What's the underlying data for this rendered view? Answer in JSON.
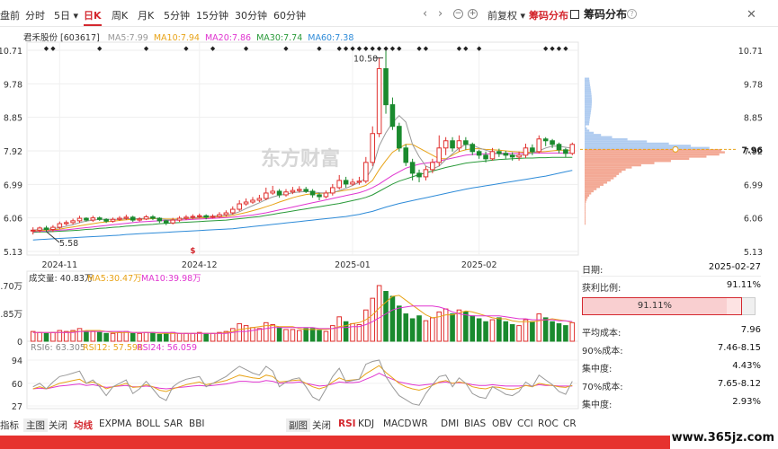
{
  "toolbar": {
    "timeframes": [
      {
        "label": "盘前",
        "active": false
      },
      {
        "label": "分时",
        "active": false
      },
      {
        "label": "5日",
        "active": false,
        "dropdown": true
      },
      {
        "label": "日K",
        "active": true
      },
      {
        "label": "周K",
        "active": false
      },
      {
        "label": "月K",
        "active": false
      },
      {
        "label": "5分钟",
        "active": false
      },
      {
        "label": "15分钟",
        "active": false
      },
      {
        "label": "30分钟",
        "active": false
      },
      {
        "label": "60分钟",
        "active": false
      }
    ],
    "adjust_label": "前复权",
    "chip_label": "筹码分布",
    "chip_toggle_label": "筹码分布"
  },
  "legend": {
    "stock": "君禾股份 [603617]",
    "ma": [
      {
        "label": "MA5:7.99",
        "color": "#999999"
      },
      {
        "label": "MA10:7.94",
        "color": "#e8a317"
      },
      {
        "label": "MA20:7.86",
        "color": "#e035d0"
      },
      {
        "label": "MA30:7.74",
        "color": "#2a9a3a"
      },
      {
        "label": "MA60:7.38",
        "color": "#2e8bd8"
      }
    ]
  },
  "price_axis": {
    "ticks": [
      "10.71",
      "9.78",
      "8.85",
      "7.92",
      "6.99",
      "6.06",
      "5.13"
    ],
    "right_ticks": [
      "10.71",
      "9.78",
      "8.85",
      "7.92",
      "6.99",
      "6.06",
      "5.13"
    ],
    "min": 5.13,
    "max": 10.71
  },
  "date_axis": [
    "2024-11",
    "2024-12",
    "2025-01",
    "2025-02"
  ],
  "annotations": {
    "high_label": "10.50",
    "low_label": "5.58",
    "current_price": "7.96",
    "watermark": "东方财富"
  },
  "volume": {
    "legend": {
      "label": "成交量: 40.83万",
      "ma5": "MA5:30.47万",
      "ma10": "MA10:39.98万"
    },
    "ticks": [
      "5.70万",
      "2.85万",
      "0"
    ]
  },
  "rsi": {
    "legend": {
      "rsi6": "RSI6: 63.305",
      "rsi12": "RSI12: 57.598",
      "rsi24": "RSI24: 56.059"
    },
    "ticks": [
      "94",
      "60",
      "27"
    ]
  },
  "chip_panel": {
    "date_label": "日期:",
    "date_value": "2025-02-27",
    "profit_label": "获利比例:",
    "profit_value": "91.11%",
    "profit_ratio": 0.9111,
    "bar_text": "91.11%",
    "stats": [
      {
        "label": "平均成本:",
        "value": "7.96"
      },
      {
        "label": "90%成本:",
        "value": "7.46-8.15"
      },
      {
        "label": "集中度:",
        "value": "4.43%"
      },
      {
        "label": "70%成本:",
        "value": "7.65-8.12"
      },
      {
        "label": "集中度:",
        "value": "2.93%"
      }
    ]
  },
  "bottom_tabs_left": [
    {
      "label": "指标",
      "active": false
    },
    {
      "label": "主图",
      "active": false,
      "box": true
    },
    {
      "label": "关闭",
      "active": false
    },
    {
      "label": "均线",
      "active": true
    },
    {
      "label": "EXPMA",
      "active": false
    },
    {
      "label": "BOLL",
      "active": false
    },
    {
      "label": "SAR",
      "active": false
    },
    {
      "label": "BBI",
      "active": false
    }
  ],
  "bottom_tabs_right": [
    {
      "label": "副图",
      "active": false,
      "box": true
    },
    {
      "label": "关闭",
      "active": false
    },
    {
      "label": "RSI",
      "active": true
    },
    {
      "label": "KDJ",
      "active": false
    },
    {
      "label": "MACD",
      "active": false
    },
    {
      "label": "WR",
      "active": false
    },
    {
      "label": "DMI",
      "active": false
    },
    {
      "label": "BIAS",
      "active": false
    },
    {
      "label": "OBV",
      "active": false
    },
    {
      "label": "CCI",
      "active": false
    },
    {
      "label": "ROC",
      "active": false
    },
    {
      "label": "CR",
      "active": false
    }
  ],
  "site_watermark": "www.365jz.com",
  "colors": {
    "up": "#e0302e",
    "down": "#1a8a2e",
    "accent": "#d4282f"
  },
  "chart_data": {
    "type": "candlestick",
    "dates": [
      "2024-10-28",
      "2024-10-29",
      "2024-10-30",
      "2024-10-31",
      "2024-11-01",
      "2024-11-04",
      "2024-11-05",
      "2024-11-06",
      "2024-11-07",
      "2024-11-08",
      "2024-11-11",
      "2024-11-12",
      "2024-11-13",
      "2024-11-14",
      "2024-11-15",
      "2024-11-18",
      "2024-11-19",
      "2024-11-20",
      "2024-11-21",
      "2024-11-22",
      "2024-11-25",
      "2024-11-26",
      "2024-11-27",
      "2024-11-28",
      "2024-11-29",
      "2024-12-02",
      "2024-12-03",
      "2024-12-04",
      "2024-12-05",
      "2024-12-06",
      "2024-12-09",
      "2024-12-10",
      "2024-12-11",
      "2024-12-12",
      "2024-12-13",
      "2024-12-16",
      "2024-12-17",
      "2024-12-18",
      "2024-12-19",
      "2024-12-20",
      "2024-12-23",
      "2024-12-24",
      "2024-12-25",
      "2024-12-26",
      "2024-12-27",
      "2024-12-30",
      "2024-12-31",
      "2025-01-02",
      "2025-01-03",
      "2025-01-06",
      "2025-01-07",
      "2025-01-08",
      "2025-01-09",
      "2025-01-10",
      "2025-01-13",
      "2025-01-14",
      "2025-01-15",
      "2025-01-16",
      "2025-01-17",
      "2025-01-20",
      "2025-01-21",
      "2025-01-22",
      "2025-01-23",
      "2025-01-24",
      "2025-01-27",
      "2025-02-05",
      "2025-02-06",
      "2025-02-07",
      "2025-02-10",
      "2025-02-11",
      "2025-02-12",
      "2025-02-13",
      "2025-02-14",
      "2025-02-17",
      "2025-02-18",
      "2025-02-19",
      "2025-02-20",
      "2025-02-21",
      "2025-02-24",
      "2025-02-25",
      "2025-02-26",
      "2025-02-27"
    ],
    "open": [
      5.7,
      5.72,
      5.78,
      5.74,
      5.8,
      5.9,
      5.93,
      5.98,
      6.05,
      6.0,
      6.06,
      6.02,
      5.97,
      6.02,
      6.05,
      6.08,
      6.0,
      6.03,
      6.09,
      6.05,
      5.98,
      5.92,
      6.0,
      6.05,
      6.08,
      6.1,
      6.12,
      6.08,
      6.1,
      6.15,
      6.2,
      6.3,
      6.45,
      6.5,
      6.55,
      6.6,
      6.75,
      6.8,
      6.7,
      6.78,
      6.82,
      6.85,
      6.8,
      6.7,
      6.65,
      6.75,
      6.9,
      7.1,
      7.0,
      7.05,
      7.08,
      7.6,
      8.4,
      10.2,
      9.2,
      8.6,
      8.0,
      7.6,
      7.3,
      7.2,
      7.4,
      7.6,
      8.0,
      8.2,
      8.0,
      8.2,
      8.1,
      7.9,
      7.8,
      7.7,
      7.9,
      7.85,
      7.8,
      7.75,
      7.8,
      8.0,
      7.9,
      8.25,
      8.2,
      8.1,
      7.95,
      7.85
    ],
    "close": [
      5.72,
      5.78,
      5.74,
      5.8,
      5.9,
      5.93,
      5.98,
      6.05,
      6.0,
      6.06,
      6.02,
      5.97,
      6.02,
      6.05,
      6.08,
      6.0,
      6.03,
      6.09,
      6.05,
      5.98,
      5.92,
      6.0,
      6.05,
      6.08,
      6.1,
      6.12,
      6.08,
      6.1,
      6.15,
      6.2,
      6.3,
      6.45,
      6.5,
      6.55,
      6.6,
      6.75,
      6.8,
      6.7,
      6.78,
      6.82,
      6.85,
      6.8,
      6.7,
      6.65,
      6.75,
      6.9,
      7.1,
      7.0,
      7.05,
      7.08,
      7.6,
      8.4,
      10.2,
      9.2,
      8.6,
      8.0,
      7.6,
      7.3,
      7.2,
      7.4,
      7.6,
      8.0,
      8.2,
      8.0,
      8.2,
      8.1,
      7.9,
      7.8,
      7.7,
      7.9,
      7.85,
      7.8,
      7.75,
      7.8,
      8.0,
      7.9,
      8.25,
      8.2,
      8.1,
      7.95,
      7.85,
      8.1
    ],
    "high": [
      5.8,
      5.82,
      5.84,
      5.86,
      5.96,
      5.99,
      6.04,
      6.12,
      6.08,
      6.12,
      6.1,
      6.05,
      6.07,
      6.11,
      6.15,
      6.12,
      6.08,
      6.14,
      6.14,
      6.08,
      6.0,
      6.06,
      6.11,
      6.14,
      6.16,
      6.18,
      6.16,
      6.16,
      6.22,
      6.27,
      6.38,
      6.55,
      6.6,
      6.64,
      6.7,
      6.9,
      6.95,
      6.86,
      6.86,
      6.92,
      6.94,
      6.92,
      6.86,
      6.76,
      6.82,
      7.0,
      7.25,
      7.2,
      7.15,
      7.2,
      7.75,
      8.6,
      10.5,
      10.71,
      9.4,
      8.7,
      8.1,
      7.7,
      7.4,
      7.5,
      7.7,
      8.35,
      8.3,
      8.3,
      8.35,
      8.3,
      8.15,
      7.95,
      7.9,
      8.0,
      7.98,
      7.92,
      7.88,
      7.9,
      8.12,
      8.1,
      8.35,
      8.3,
      8.25,
      8.15,
      8.0,
      8.15
    ],
    "low": [
      5.6,
      5.65,
      5.68,
      5.67,
      5.75,
      5.85,
      5.88,
      5.92,
      5.96,
      5.95,
      5.98,
      5.92,
      5.93,
      5.98,
      6.0,
      5.95,
      5.96,
      6.0,
      6.0,
      5.92,
      5.86,
      5.88,
      5.95,
      6.0,
      6.02,
      6.05,
      6.02,
      6.04,
      6.06,
      6.1,
      6.15,
      6.25,
      6.4,
      6.45,
      6.5,
      6.55,
      6.7,
      6.62,
      6.65,
      6.72,
      6.76,
      6.75,
      6.62,
      6.55,
      6.6,
      6.68,
      6.85,
      6.9,
      6.95,
      6.98,
      7.02,
      7.5,
      8.3,
      8.95,
      8.5,
      7.9,
      7.5,
      7.1,
      7.05,
      7.1,
      7.3,
      7.5,
      7.8,
      7.9,
      7.9,
      7.95,
      7.8,
      7.7,
      7.6,
      7.65,
      7.75,
      7.7,
      7.65,
      7.65,
      7.72,
      7.8,
      7.85,
      8.05,
      8.0,
      7.85,
      7.75,
      7.8
    ],
    "volume": [
      1.0,
      0.9,
      0.8,
      0.9,
      1.1,
      1.0,
      1.1,
      1.3,
      1.0,
      1.0,
      0.9,
      0.8,
      0.8,
      0.9,
      1.0,
      0.8,
      0.8,
      0.9,
      0.9,
      0.7,
      0.8,
      0.9,
      0.8,
      0.8,
      0.8,
      0.9,
      0.8,
      0.8,
      0.9,
      1.0,
      1.3,
      1.8,
      1.6,
      1.4,
      1.3,
      1.9,
      1.7,
      1.4,
      1.2,
      1.2,
      1.1,
      1.3,
      1.3,
      1.1,
      1.0,
      1.6,
      2.5,
      2.0,
      1.8,
      1.7,
      3.2,
      4.4,
      5.7,
      5.1,
      4.6,
      3.6,
      2.8,
      2.3,
      2.6,
      2.1,
      2.4,
      3.0,
      3.3,
      2.8,
      3.2,
      3.0,
      2.6,
      2.3,
      2.0,
      2.2,
      2.4,
      2.0,
      1.7,
      1.6,
      2.2,
      2.0,
      2.8,
      2.4,
      2.0,
      1.8,
      1.6,
      1.9
    ],
    "ma5": [
      5.72,
      5.74,
      5.75,
      5.76,
      5.79,
      5.83,
      5.87,
      5.93,
      5.97,
      6.0,
      6.02,
      6.02,
      6.02,
      6.02,
      6.04,
      6.04,
      6.04,
      6.05,
      6.06,
      6.04,
      6.01,
      6.01,
      6.02,
      6.05,
      6.06,
      6.08,
      6.1,
      6.11,
      6.12,
      6.14,
      6.17,
      6.23,
      6.32,
      6.4,
      6.48,
      6.57,
      6.64,
      6.69,
      6.72,
      6.76,
      6.78,
      6.79,
      6.78,
      6.76,
      6.75,
      6.76,
      6.82,
      6.88,
      6.96,
      7.05,
      7.16,
      7.44,
      8.06,
      8.42,
      8.7,
      8.9,
      8.72,
      8.1,
      7.76,
      7.5,
      7.42,
      7.5,
      7.68,
      7.84,
      8.0,
      8.1,
      8.08,
      8.0,
      7.94,
      7.88,
      7.83,
      7.83,
      7.8,
      7.79,
      7.82,
      7.86,
      7.92,
      8.0,
      8.05,
      8.05,
      8.02,
      7.99
    ],
    "ma10": [
      5.7,
      5.71,
      5.72,
      5.73,
      5.75,
      5.78,
      5.81,
      5.84,
      5.87,
      5.9,
      5.93,
      5.95,
      5.97,
      5.99,
      6.01,
      6.02,
      6.03,
      6.03,
      6.04,
      6.04,
      6.03,
      6.03,
      6.03,
      6.04,
      6.05,
      6.06,
      6.07,
      6.08,
      6.09,
      6.1,
      6.13,
      6.17,
      6.21,
      6.26,
      6.31,
      6.37,
      6.43,
      6.5,
      6.56,
      6.62,
      6.67,
      6.71,
      6.73,
      6.74,
      6.75,
      6.77,
      6.8,
      6.83,
      6.86,
      6.9,
      6.96,
      7.1,
      7.4,
      7.65,
      7.88,
      8.0,
      8.1,
      8.1,
      8.0,
      7.9,
      7.8,
      7.7,
      7.7,
      7.8,
      7.9,
      7.95,
      7.98,
      7.98,
      7.96,
      7.95,
      7.94,
      7.92,
      7.9,
      7.89,
      7.88,
      7.88,
      7.89,
      7.9,
      7.92,
      7.94,
      7.94,
      7.94
    ],
    "ma20": [
      5.68,
      5.69,
      5.7,
      5.71,
      5.72,
      5.73,
      5.75,
      5.77,
      5.79,
      5.81,
      5.83,
      5.85,
      5.87,
      5.89,
      5.91,
      5.93,
      5.95,
      5.96,
      5.97,
      5.98,
      5.99,
      6.0,
      6.0,
      6.01,
      6.02,
      6.03,
      6.04,
      6.05,
      6.06,
      6.07,
      6.08,
      6.1,
      6.12,
      6.14,
      6.17,
      6.2,
      6.24,
      6.28,
      6.32,
      6.36,
      6.4,
      6.44,
      6.48,
      6.52,
      6.56,
      6.6,
      6.64,
      6.68,
      6.72,
      6.76,
      6.82,
      6.9,
      7.0,
      7.12,
      7.24,
      7.34,
      7.44,
      7.5,
      7.55,
      7.58,
      7.6,
      7.64,
      7.68,
      7.72,
      7.76,
      7.8,
      7.82,
      7.83,
      7.84,
      7.84,
      7.85,
      7.85,
      7.85,
      7.85,
      7.85,
      7.86,
      7.86,
      7.86,
      7.86,
      7.86,
      7.86,
      7.86
    ],
    "ma30": [
      5.66,
      5.67,
      5.67,
      5.68,
      5.69,
      5.7,
      5.71,
      5.72,
      5.74,
      5.75,
      5.77,
      5.78,
      5.8,
      5.81,
      5.83,
      5.84,
      5.86,
      5.87,
      5.88,
      5.9,
      5.91,
      5.92,
      5.93,
      5.94,
      5.95,
      5.96,
      5.97,
      5.98,
      5.99,
      6.0,
      6.02,
      6.04,
      6.06,
      6.08,
      6.1,
      6.13,
      6.16,
      6.19,
      6.22,
      6.25,
      6.28,
      6.31,
      6.34,
      6.37,
      6.4,
      6.43,
      6.46,
      6.5,
      6.54,
      6.58,
      6.63,
      6.7,
      6.8,
      6.9,
      7.0,
      7.08,
      7.14,
      7.2,
      7.26,
      7.31,
      7.36,
      7.41,
      7.46,
      7.5,
      7.54,
      7.58,
      7.6,
      7.62,
      7.64,
      7.66,
      7.68,
      7.69,
      7.7,
      7.71,
      7.72,
      7.72,
      7.73,
      7.73,
      7.74,
      7.74,
      7.74,
      7.74
    ],
    "ma60": [
      5.45,
      5.46,
      5.47,
      5.48,
      5.49,
      5.5,
      5.51,
      5.52,
      5.53,
      5.54,
      5.55,
      5.56,
      5.57,
      5.58,
      5.6,
      5.61,
      5.62,
      5.63,
      5.64,
      5.65,
      5.66,
      5.67,
      5.68,
      5.69,
      5.7,
      5.71,
      5.72,
      5.73,
      5.74,
      5.75,
      5.76,
      5.78,
      5.8,
      5.82,
      5.84,
      5.86,
      5.88,
      5.9,
      5.92,
      5.94,
      5.96,
      5.98,
      6.0,
      6.02,
      6.04,
      6.06,
      6.08,
      6.1,
      6.13,
      6.16,
      6.2,
      6.24,
      6.3,
      6.36,
      6.41,
      6.46,
      6.5,
      6.54,
      6.58,
      6.62,
      6.66,
      6.7,
      6.74,
      6.78,
      6.82,
      6.86,
      6.89,
      6.92,
      6.95,
      6.98,
      7.01,
      7.04,
      7.07,
      7.1,
      7.13,
      7.16,
      7.19,
      7.22,
      7.26,
      7.3,
      7.34,
      7.38
    ],
    "vol_ma5": [
      0.9,
      0.9,
      0.9,
      0.9,
      0.9,
      0.9,
      1.0,
      1.0,
      1.1,
      1.1,
      1.1,
      1.0,
      0.9,
      0.9,
      0.9,
      0.9,
      0.9,
      0.9,
      0.9,
      0.8,
      0.8,
      0.8,
      0.8,
      0.8,
      0.8,
      0.8,
      0.8,
      0.8,
      0.8,
      0.9,
      1.0,
      1.2,
      1.3,
      1.4,
      1.5,
      1.6,
      1.6,
      1.5,
      1.5,
      1.5,
      1.3,
      1.2,
      1.2,
      1.2,
      1.2,
      1.3,
      1.5,
      1.6,
      1.8,
      1.9,
      2.2,
      2.7,
      3.4,
      4.0,
      4.6,
      4.7,
      4.2,
      3.7,
      3.2,
      2.7,
      2.4,
      2.5,
      2.7,
      2.7,
      2.9,
      3.1,
      3.0,
      2.8,
      2.6,
      2.4,
      2.3,
      2.3,
      2.1,
      2.0,
      2.0,
      2.0,
      2.1,
      2.2,
      2.3,
      2.2,
      2.1,
      1.9
    ],
    "vol_ma10": [
      0.9,
      0.9,
      0.9,
      0.9,
      0.9,
      0.9,
      0.9,
      1.0,
      1.0,
      1.0,
      1.0,
      1.0,
      1.0,
      1.0,
      1.0,
      0.9,
      0.9,
      0.9,
      0.9,
      0.9,
      0.9,
      0.9,
      0.8,
      0.8,
      0.8,
      0.8,
      0.8,
      0.8,
      0.8,
      0.8,
      0.9,
      1.0,
      1.0,
      1.1,
      1.2,
      1.3,
      1.4,
      1.4,
      1.4,
      1.4,
      1.4,
      1.4,
      1.4,
      1.3,
      1.3,
      1.3,
      1.4,
      1.4,
      1.5,
      1.5,
      1.7,
      2.0,
      2.4,
      2.8,
      3.2,
      3.4,
      3.5,
      3.6,
      3.6,
      3.6,
      3.6,
      3.5,
      3.3,
      3.0,
      2.8,
      2.7,
      2.6,
      2.6,
      2.6,
      2.6,
      2.6,
      2.5,
      2.4,
      2.3,
      2.3,
      2.2,
      2.2,
      2.2,
      2.2,
      2.1,
      2.1,
      2.0
    ],
    "rsi6": [
      55,
      60,
      52,
      62,
      70,
      72,
      75,
      78,
      60,
      65,
      55,
      42,
      55,
      60,
      65,
      45,
      52,
      63,
      52,
      40,
      35,
      55,
      62,
      66,
      68,
      70,
      55,
      60,
      65,
      70,
      78,
      85,
      80,
      75,
      72,
      85,
      78,
      55,
      62,
      66,
      68,
      55,
      40,
      35,
      52,
      70,
      82,
      62,
      64,
      66,
      88,
      92,
      94,
      70,
      55,
      42,
      36,
      30,
      28,
      45,
      58,
      70,
      72,
      55,
      68,
      60,
      45,
      40,
      38,
      55,
      50,
      44,
      42,
      48,
      62,
      55,
      72,
      65,
      58,
      48,
      44,
      63
    ],
    "rsi12": [
      52,
      55,
      52,
      56,
      60,
      62,
      64,
      66,
      60,
      62,
      58,
      52,
      55,
      57,
      60,
      54,
      55,
      58,
      55,
      50,
      48,
      52,
      55,
      58,
      60,
      62,
      58,
      60,
      62,
      64,
      68,
      72,
      70,
      68,
      67,
      72,
      70,
      62,
      63,
      64,
      65,
      60,
      55,
      52,
      55,
      62,
      68,
      64,
      65,
      66,
      74,
      80,
      86,
      76,
      68,
      60,
      55,
      52,
      50,
      53,
      57,
      62,
      64,
      60,
      62,
      60,
      55,
      53,
      52,
      55,
      54,
      52,
      51,
      53,
      57,
      55,
      60,
      58,
      57,
      55,
      54,
      57
    ],
    "rsi24": [
      52,
      53,
      52,
      54,
      56,
      57,
      58,
      59,
      57,
      58,
      56,
      54,
      55,
      56,
      57,
      55,
      55,
      56,
      55,
      53,
      52,
      53,
      54,
      55,
      56,
      57,
      56,
      57,
      58,
      59,
      61,
      63,
      63,
      62,
      62,
      64,
      63,
      60,
      61,
      61,
      62,
      60,
      58,
      56,
      57,
      59,
      62,
      61,
      61,
      62,
      66,
      70,
      75,
      70,
      66,
      62,
      60,
      58,
      57,
      58,
      59,
      61,
      62,
      60,
      61,
      60,
      58,
      57,
      57,
      58,
      57,
      56,
      56,
      56,
      57,
      56,
      58,
      57,
      57,
      56,
      56,
      56
    ]
  }
}
